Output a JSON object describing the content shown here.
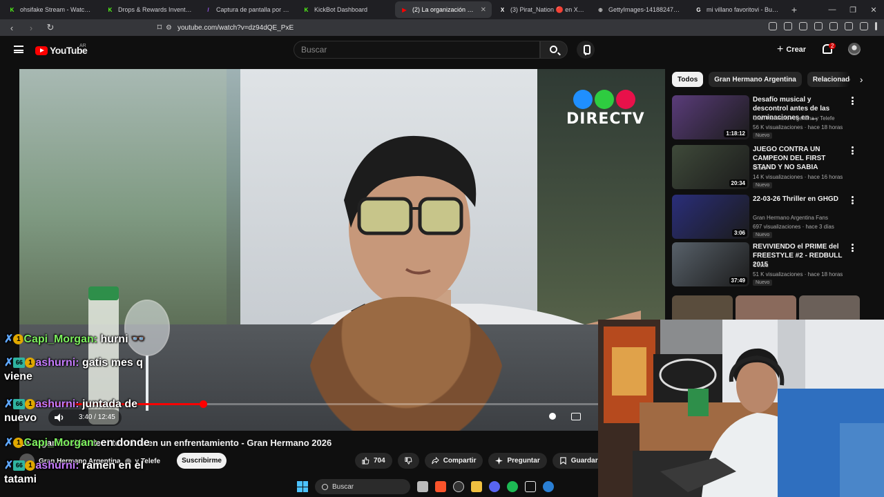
{
  "browser": {
    "tabs": [
      {
        "label": "ohsifake Stream - Watch Li",
        "fav_color": "#53fc18",
        "fav_text": "K",
        "active": false
      },
      {
        "label": "Drops & Rewards Inventory - K",
        "fav_color": "#53fc18",
        "fav_text": "K",
        "active": false
      },
      {
        "label": "Captura de pantalla por Lightsh",
        "fav_color": "#a35cff",
        "fav_text": "/",
        "active": false
      },
      {
        "label": "KickBot Dashboard",
        "fav_color": "#53fc18",
        "fav_text": "K",
        "active": false
      },
      {
        "label": "(2) La organización de la",
        "fav_color": "#ff0000",
        "fav_text": "▶",
        "active": true
      },
      {
        "label": "(3) Pirat_Nation 🔴 en X: \"Cap",
        "fav_color": "#ffffff",
        "fav_text": "X",
        "active": false
      },
      {
        "label": "GettyImages-1418824798.jpg",
        "fav_color": "#cccccc",
        "fav_text": "⊕",
        "active": false
      },
      {
        "label": "mi villano favoritovi - Buscar c",
        "fav_color": "#ffffff",
        "fav_text": "G",
        "active": false
      }
    ],
    "url": "youtube.com/watch?v=dz94dQE_PxE"
  },
  "youtube": {
    "logo_text": "YouTube",
    "country": "AR",
    "search_placeholder": "Buscar",
    "create_label": "Crear",
    "notif_count": "2"
  },
  "player": {
    "time": "3:40 / 12:45",
    "progress": 0.29,
    "watermark_text": "DIRECTV",
    "watermark_circles": [
      "#1f8fff",
      "#2ecc40",
      "#e8114a"
    ]
  },
  "video_info": {
    "title": "La organización de… terminó en un enfrentamiento - Gran Hermano 2026",
    "channel": "Gran Hermano Argentina",
    "channel_and": "y Telefe",
    "subscribe_label": "Suscribirme",
    "likes": "704",
    "share_label": "Compartir",
    "ask_label": "Preguntar",
    "save_label": "Guardar"
  },
  "chat": [
    {
      "user": "Capi_Morgan:",
      "text": " hurni 👓",
      "user_color": "green",
      "badges": [
        "sword",
        "1"
      ]
    },
    {
      "user": "ashurni:",
      "text": " gatis mes q",
      "cont": "viene",
      "user_color": "purple",
      "badges": [
        "sword",
        "66",
        "1"
      ]
    },
    {
      "user": "ashurni:",
      "text": " juntada de",
      "cont": "nuevo",
      "user_color": "purple",
      "badges": [
        "sword",
        "66",
        "1"
      ]
    },
    {
      "user": "Capi_Morgan:",
      "text": " en donde",
      "user_color": "green",
      "badges": [
        "sword",
        "1"
      ]
    },
    {
      "user": "ashurni:",
      "text": " ramen en el",
      "cont": "tatami",
      "user_color": "purple",
      "badges": [
        "sword",
        "66",
        "1"
      ]
    }
  ],
  "sidebar": {
    "chips": [
      "Todos",
      "Gran Hermano Argentina",
      "Relacionados"
    ],
    "videos": [
      {
        "title": "Desafío musical y descontrol antes de las nominaciones en ...",
        "channel": "Gran Hermano Argentina",
        "channel_and": "y Telefe",
        "meta": "56 K visualizaciones · hace 18 horas",
        "badge": "Nuevo",
        "duration": "1:18:12",
        "thumb": "#5a3c7a"
      },
      {
        "title": "JUEGO CONTRA UN CAMPEON DEL FIRST STAND Y NO SABIA",
        "channel": "Grafo",
        "channel_and": "",
        "meta": "14 K visualizaciones · hace 16 horas",
        "badge": "Nuevo",
        "duration": "20:34",
        "thumb": "#3f4a3a"
      },
      {
        "title": "22-03-26 Thriller en GHGD",
        "channel": "Gran Hermano Argentina Fans",
        "channel_and": "",
        "meta": "697 visualizaciones · hace 3 días",
        "badge": "Nuevo",
        "duration": "3:06",
        "thumb": "#2a2e7a"
      },
      {
        "title": "REVIVIENDO el PRIME del FREESTYLE #2 - REDBULL 2015",
        "channel": "Coscu",
        "channel_and": "",
        "meta": "51 K visualizaciones · hace 18 horas",
        "badge": "Nuevo",
        "duration": "37:49",
        "thumb": "#58616a"
      }
    ]
  },
  "taskbar": {
    "search_label": "Buscar"
  }
}
